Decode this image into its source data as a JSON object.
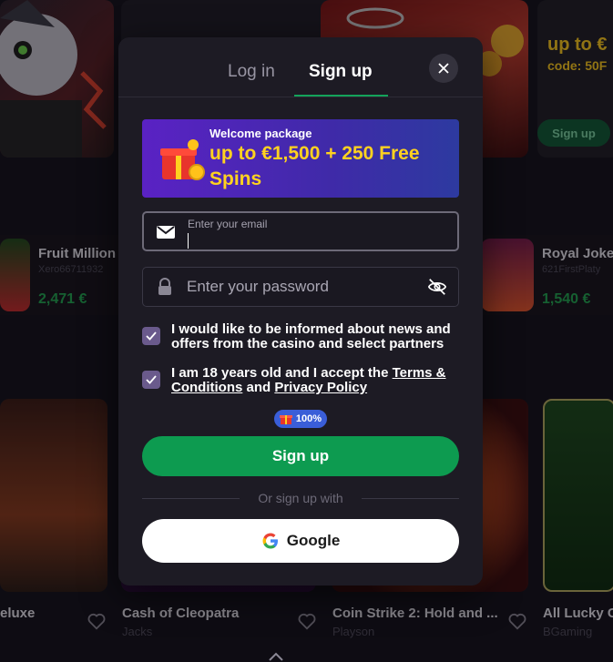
{
  "background": {
    "cards": [
      {
        "title": "Fruit Million",
        "provider": "Xero66711932",
        "win": "2,471 €"
      },
      {
        "title": "Royal Joke",
        "provider": "621FirstPlaty",
        "win": "1,540 €"
      },
      {
        "title": "eluxe",
        "provider": ""
      },
      {
        "title": "Cash of Cleopatra",
        "provider": "Jacks"
      },
      {
        "title": "Coin Strike 2: Hold and ...",
        "provider": "Playson"
      },
      {
        "title": "All Lucky C",
        "provider": "BGaming"
      }
    ],
    "promo_text": "up to €",
    "promo_code": "code: 50F",
    "promo_button": "Sign up"
  },
  "modal": {
    "tabs": {
      "login": "Log in",
      "signup": "Sign up"
    },
    "welcome": {
      "title": "Welcome package",
      "offer": "up to €1,500 + 250 Free Spins"
    },
    "email": {
      "label": "Enter your email",
      "value": ""
    },
    "password": {
      "placeholder": "Enter your password"
    },
    "checks": {
      "news": "I would like to be informed about news and offers from the casino and select partners",
      "age_prefix": "I am 18 years old and I accept the",
      "terms": "Terms & Conditions",
      "and": "and",
      "privacy": "Privacy Policy"
    },
    "badge": "100%",
    "signup_button": "Sign up",
    "divider": "Or sign up with",
    "google_button": "Google"
  },
  "colors": {
    "accent": "#0d9b50",
    "promo_yellow": "#ffd21f",
    "checkbox": "#6a5a8c",
    "badge": "#3a5ed8"
  }
}
